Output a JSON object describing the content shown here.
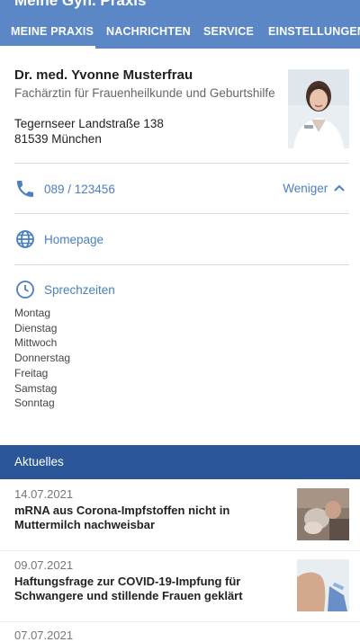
{
  "app": {
    "title": "Meine Gyn. Praxis"
  },
  "tabs": [
    {
      "label": "MEINE PRAXIS",
      "active": true
    },
    {
      "label": "NACHRICHTEN",
      "active": false
    },
    {
      "label": "SERVICE",
      "active": false
    },
    {
      "label": "EINSTELLUNGEN",
      "active": false
    }
  ],
  "doctor": {
    "name": "Dr. med. Yvonne Musterfrau",
    "specialty": "Fachärztin für Frauenheilkunde und Geburtshilfe",
    "street": "Tegernseer Landstraße 138",
    "city": "81539 München"
  },
  "contact": {
    "phone": "089 / 123456",
    "toggle_label": "Weniger",
    "homepage_label": "Homepage",
    "hours_label": "Sprechzeiten",
    "days": [
      "Montag",
      "Dienstag",
      "Mittwoch",
      "Donnerstag",
      "Freitag",
      "Samstag",
      "Sonntag"
    ]
  },
  "news": {
    "header": "Aktuelles",
    "items": [
      {
        "date": "14.07.2021",
        "title": "mRNA aus Corona-Impfstoffen nicht in Muttermilch nachweisbar"
      },
      {
        "date": "09.07.2021",
        "title": "Haftungsfrage zur COVID-19-Impfung für Schwangere und stillende Frauen geklärt"
      },
      {
        "date": "07.07.2021",
        "title": ""
      }
    ]
  },
  "colors": {
    "appbar": "#5b87c6",
    "accent": "#4a7fc0",
    "news_header": "#2a5599"
  },
  "icons": {
    "phone": "phone-icon",
    "homepage": "globe-icon",
    "hours": "clock-icon",
    "toggle": "chevron-up-icon"
  }
}
